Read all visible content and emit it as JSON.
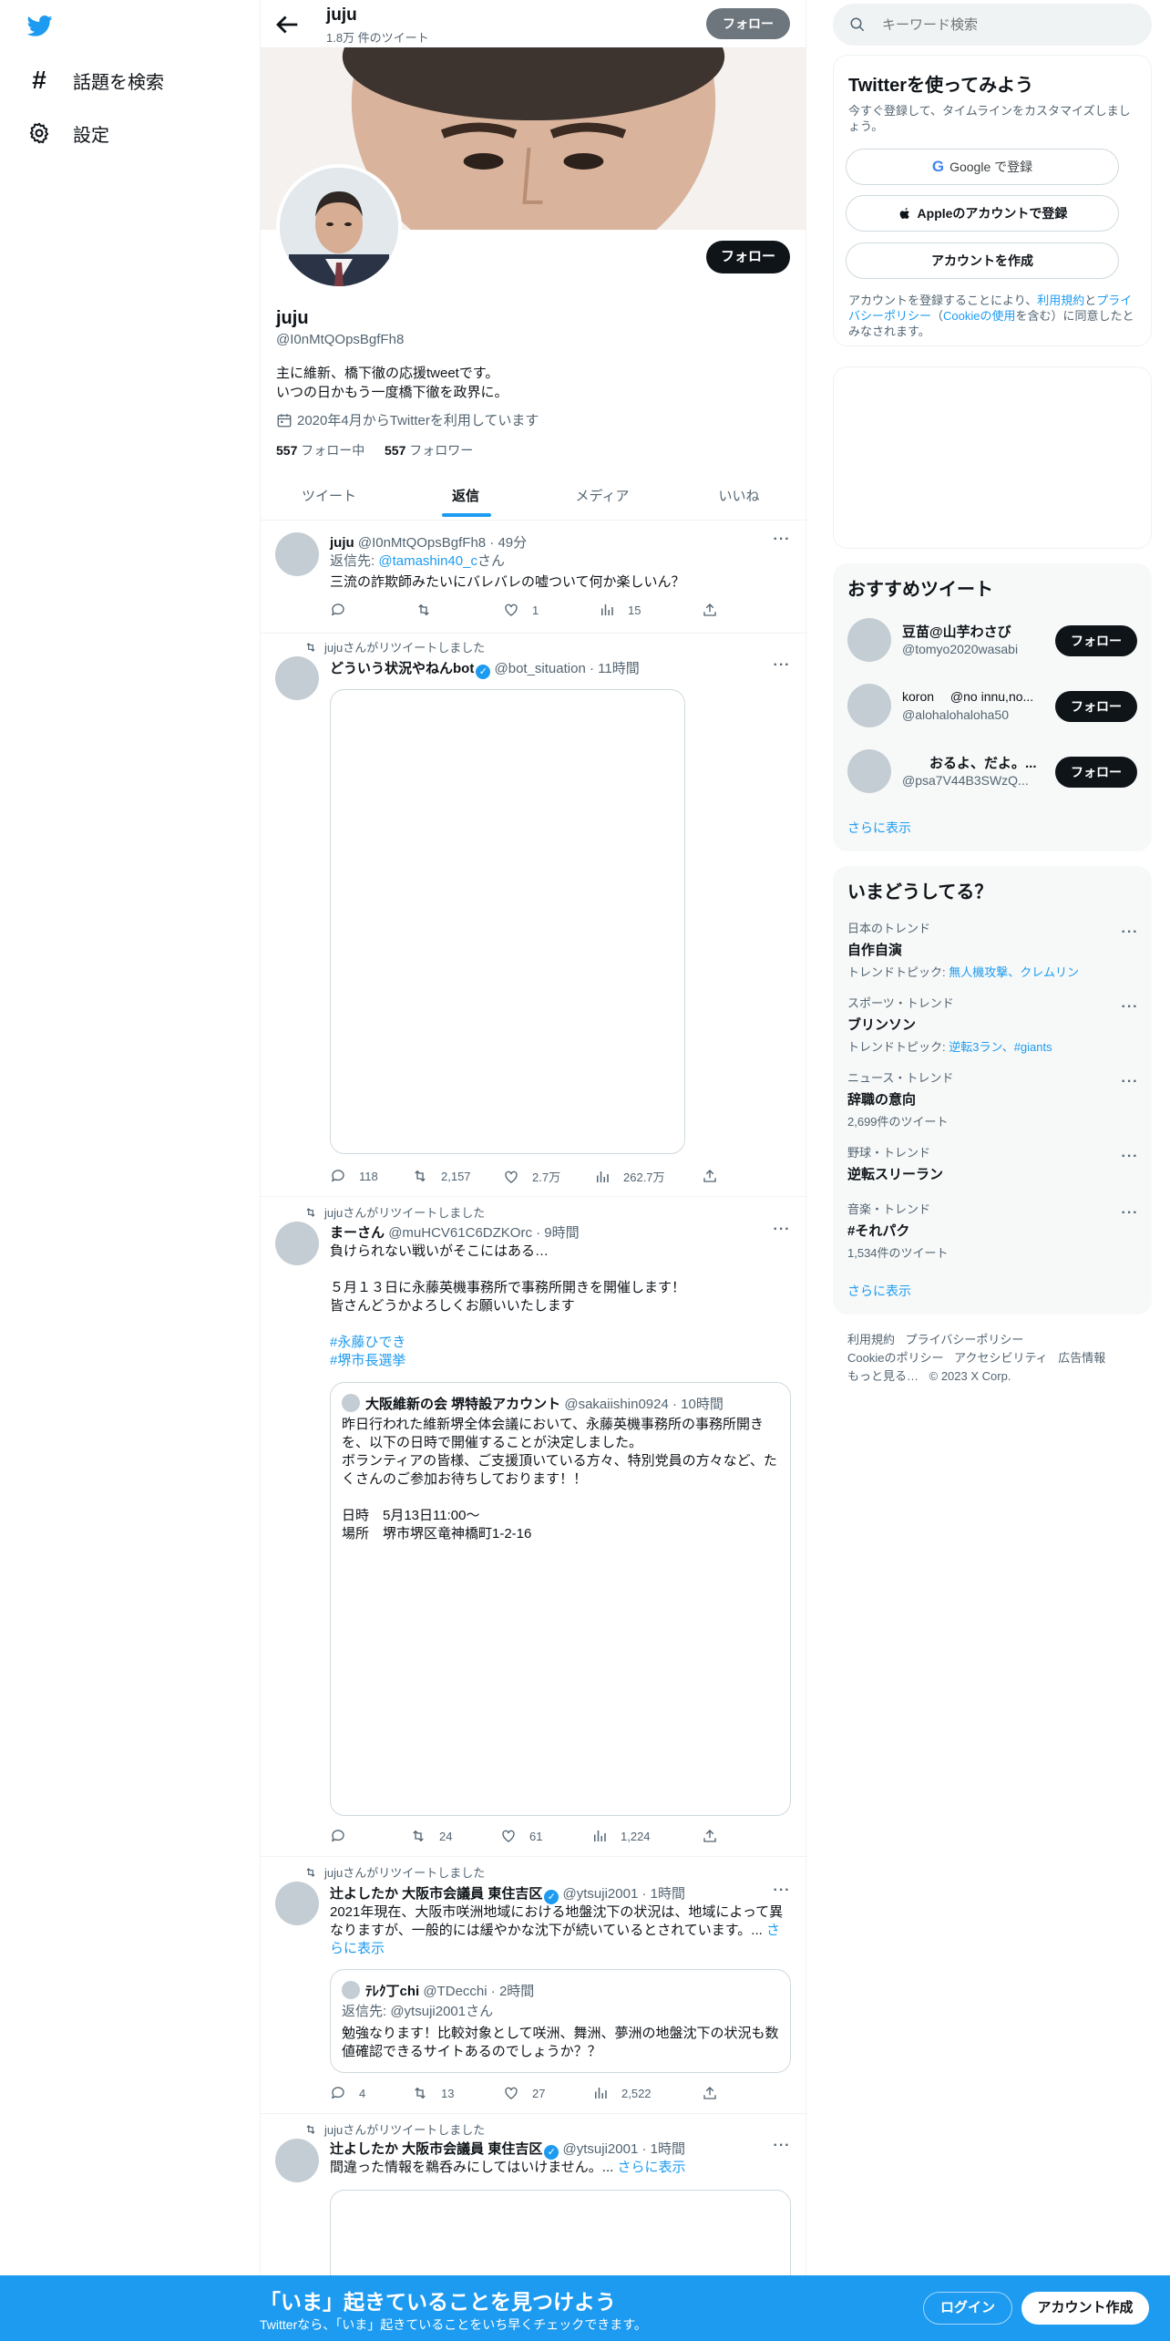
{
  "nav": {
    "explore_label": "話題を検索",
    "settings_label": "設定"
  },
  "header": {
    "name": "juju",
    "tweet_count": "1.8万 件のツイート",
    "follow_label": "フォロー"
  },
  "profile": {
    "name": "juju",
    "handle": "@I0nMtQOpsBgfFh8",
    "bio_line1": "主に維新、橋下徹の応援tweetです。",
    "bio_line2": "いつの日かもう一度橋下徹を政界に。",
    "joined": "2020年4月からTwitterを利用しています",
    "following_count": "557",
    "following_label": "フォロー中",
    "followers_count": "557",
    "followers_label": "フォロワー",
    "follow_label": "フォロー"
  },
  "tabs": [
    {
      "label": "ツイート",
      "active": false
    },
    {
      "label": "返信",
      "active": true
    },
    {
      "label": "メディア",
      "active": false
    },
    {
      "label": "いいね",
      "active": false
    }
  ],
  "tweets": [
    {
      "name": "juju",
      "handle": "@I0nMtQOpsBgfFh8",
      "time": "49分",
      "reply_to_label": "返信先:",
      "reply_to": "@tamashin40_c",
      "reply_suffix": "さん",
      "text": "三流の詐欺師みたいにバレバレの嘘ついて何か楽しいん？",
      "replies": "",
      "retweets": "",
      "likes": "1",
      "views": "15"
    },
    {
      "retweeted_by": "jujuさんがリツイートしました",
      "name": "どういう状況やねんbot",
      "handle": "@bot_situation",
      "time": "11時間",
      "replies": "118",
      "retweets": "2,157",
      "likes": "2.7万",
      "views": "262.7万"
    },
    {
      "retweeted_by": "jujuさんがリツイートしました",
      "name": "まーさん",
      "handle": "@muHCV61C6DZKOrc",
      "time": "9時間",
      "line1": "負けられない戦いがそこにはある…",
      "line2": "５月１３日に永藤英機事務所で事務所開きを開催します！",
      "line3": "皆さんどうかよろしくお願いいたします",
      "hashtag1": "#永藤ひでき",
      "hashtag2": "#堺市長選挙",
      "quote": {
        "name": "大阪維新の会 堺特設アカウント",
        "handle": "@sakaiishin0924",
        "time": "10時間",
        "line1": "昨日行われた維新堺全体会議において、永藤英機事務所の事務所開きを、以下の日時で開催することが決定しました。",
        "line2": "ボランティアの皆様、ご支援頂いている方々、特別党員の方々など、たくさんのご参加お待ちしております！！",
        "line3": "日時　5月13日11:00〜",
        "line4": "場所　堺市堺区竜神橋町1-2-16"
      },
      "replies": "",
      "retweets": "24",
      "likes": "61",
      "views": "1,224"
    },
    {
      "retweeted_by": "jujuさんがリツイートしました",
      "name": "辻よしたか 大阪市会議員 東住吉区",
      "handle": "@ytsuji2001",
      "time": "1時間",
      "text": "2021年現在、大阪市咲洲地域における地盤沈下の状況は、地域によって異なりますが、一般的には緩やかな沈下が続いているとされています。...",
      "more_link": "さらに表示",
      "quote": {
        "name": "ﾃﾚｸ丁chi",
        "handle": "@TDecchi",
        "time": "2時間",
        "reply_to": "返信先: @ytsuji2001さん",
        "text": "勉強なります！比較対象として咲洲、舞洲、夢洲の地盤沈下の状況も数値確認できるサイトあるのでしょうか？？"
      },
      "replies": "4",
      "retweets": "13",
      "likes": "27",
      "views": "2,522"
    },
    {
      "retweeted_by": "jujuさんがリツイートしました",
      "name": "辻よしたか 大阪市会議員 東住吉区",
      "handle": "@ytsuji2001",
      "time": "1時間",
      "text": "間違った情報を鵜呑みにしてはいけません。...",
      "more_link": "さらに表示"
    }
  ],
  "right": {
    "search_placeholder": "キーワード検索",
    "signup": {
      "title": "Twitterを使ってみよう",
      "subtitle": "今すぐ登録して、タイムラインをカスタマイズしましょう。",
      "google": "Google で登録",
      "apple": "Appleのアカウントで登録",
      "create": "アカウントを作成",
      "legal_pre": "アカウントを登録することにより、",
      "legal_terms": "利用規約",
      "legal_and": "と",
      "legal_privacy": "プライバシーポリシー",
      "legal_paren_open": "（",
      "legal_cookie": "Cookieの使用",
      "legal_post": "を含む）に同意したとみなされます。"
    },
    "recommend": {
      "title": "おすすめツイート",
      "users": [
        {
          "name": "豆苗@山芋わさび",
          "handle": "@tomyo2020wasabi",
          "follow": "フォロー"
        },
        {
          "name": "koron　 @no innu,no...",
          "handle": "@alohalohaloha50",
          "follow": "フォロー"
        },
        {
          "name": "　　おるよ、だよ。...",
          "handle": "@psa7V44B3SWzQ...",
          "follow": "フォロー"
        }
      ],
      "more": "さらに表示"
    },
    "trends": {
      "title": "いまどうしてる？",
      "items": [
        {
          "meta": "日本のトレンド",
          "name": "自作自演",
          "sub_label": "トレンドトピック:",
          "sub_links": "無人機攻撃、クレムリン"
        },
        {
          "meta": "スポーツ・トレンド",
          "name": "ブリンソン",
          "sub_label": "トレンドトピック:",
          "sub_links": "逆転3ラン、#giants"
        },
        {
          "meta": "ニュース・トレンド",
          "name": "辞職の意向",
          "sub": "2,699件のツイート"
        },
        {
          "meta": "野球・トレンド",
          "name": "逆転スリーラン",
          "sub": ""
        },
        {
          "meta": "音楽・トレンド",
          "name": "#それパク",
          "sub": "1,534件のツイート"
        }
      ],
      "more": "さらに表示"
    },
    "footer": {
      "terms": "利用規約",
      "privacy": "プライバシーポリシー",
      "cookie": "Cookieのポリシー",
      "access": "アクセシビリティ",
      "ads": "広告情報",
      "more": "もっと見る…",
      "copy": "© 2023 X Corp."
    }
  },
  "bottom": {
    "title": "「いま」起きていることを見つけよう",
    "subtitle": "Twitterなら、「いま」起きていることをいち早くチェックできます。",
    "login": "ログイン",
    "signup": "アカウント作成"
  },
  "colors": {
    "accent": "#1d9bf0",
    "text": "#0f1419",
    "muted": "#536471"
  }
}
